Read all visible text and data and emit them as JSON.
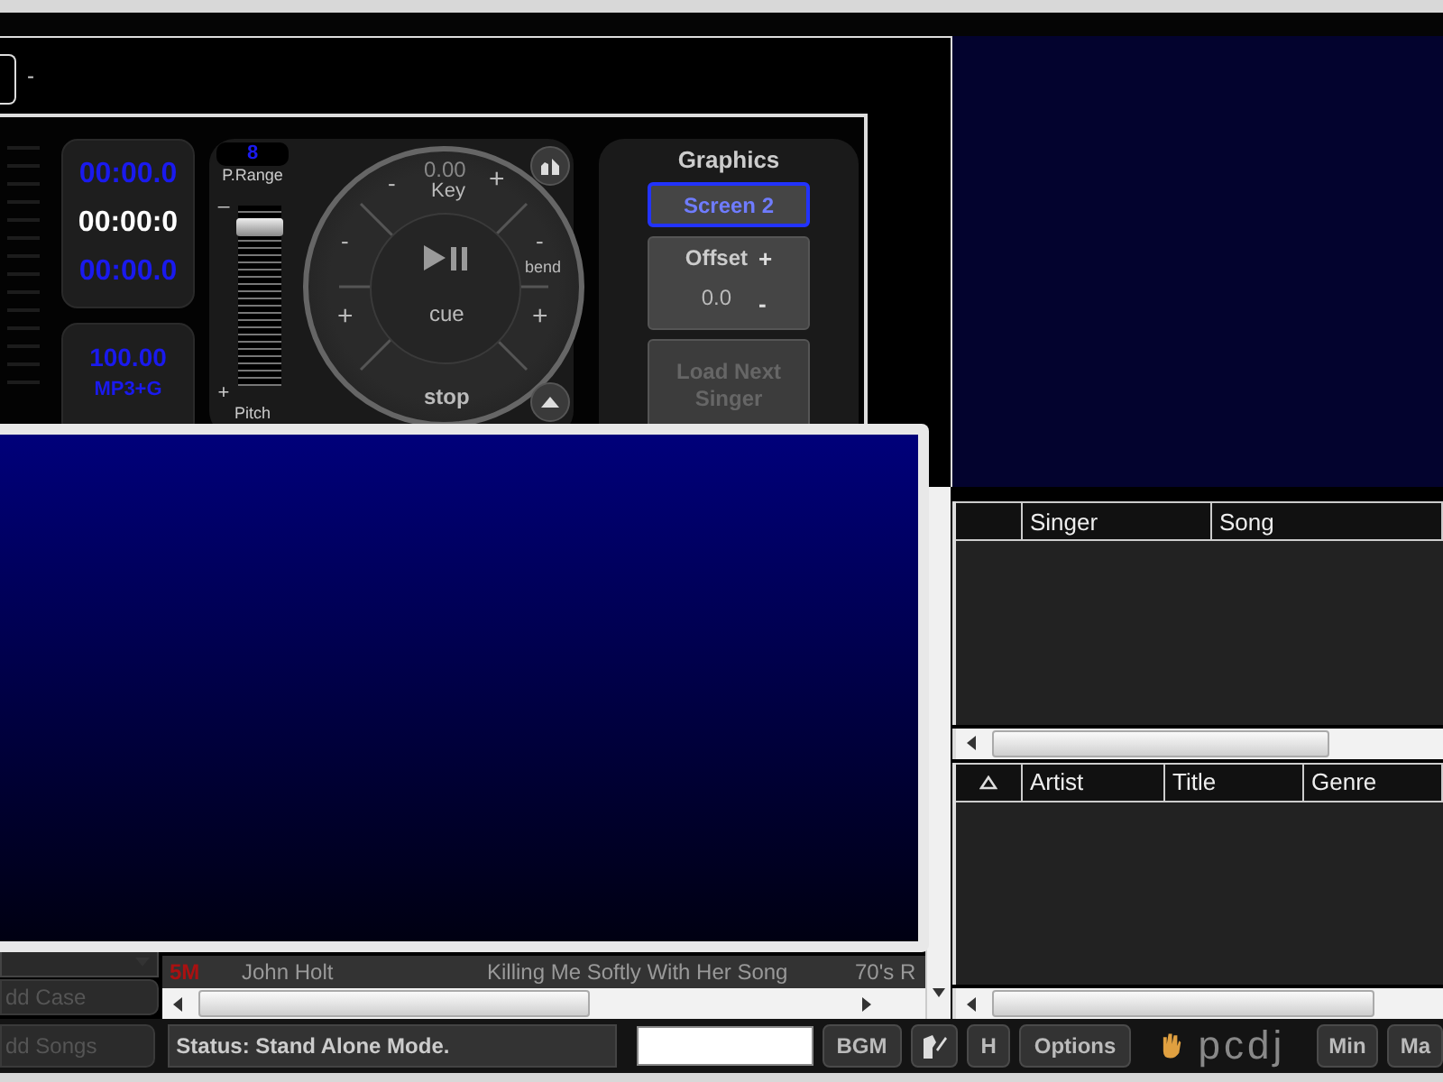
{
  "deck": {
    "top_label": "-",
    "times": [
      {
        "text": "00:00.0",
        "kind": "remaining"
      },
      {
        "text": "00:00:0",
        "kind": "elapsed"
      },
      {
        "text": "00:00.0",
        "kind": "remaining"
      }
    ],
    "bpm": "100.00",
    "format": "MP3+G",
    "pitch": {
      "range_value": "8",
      "range_label": "P.Range",
      "minus": "_",
      "plus": "+",
      "label": "Pitch",
      "level": 0.92
    },
    "jog": {
      "key_value": "0.00",
      "key_label": "Key",
      "key_minus": "-",
      "key_plus": "+",
      "left_minus": "-",
      "right_minus": "-",
      "bend_label": "bend",
      "left_plus": "+",
      "right_plus": "+",
      "cue": "cue",
      "stop": "stop"
    },
    "graphics": {
      "title": "Graphics",
      "screen": "Screen 2",
      "offset_label": "Offset",
      "offset_plus": "+",
      "offset_value": "0.0",
      "offset_minus": "-",
      "load_next": "Load Next Singer",
      "load_next_disabled": true
    }
  },
  "song_row": {
    "badge": "5M",
    "artist": "John Holt",
    "title": "Killing Me Softly With Her Song",
    "genre": "70's R"
  },
  "left_buttons": [
    "dd Case",
    "dd Songs"
  ],
  "rotation": {
    "columns": [
      "Singer",
      "Song"
    ]
  },
  "catalog": {
    "columns": [
      "Artist",
      "Title",
      "Genre"
    ]
  },
  "status_bar": {
    "status": "Status: Stand Alone Mode.",
    "buttons": [
      "BGM",
      "H",
      "Options"
    ],
    "logo": "pcdj",
    "window_buttons": [
      "Min",
      "Ma"
    ]
  }
}
